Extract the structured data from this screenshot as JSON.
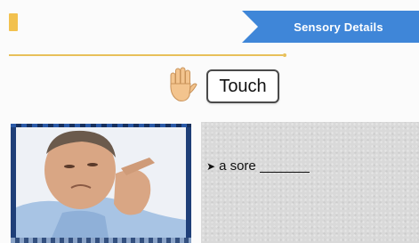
{
  "header": {
    "banner_title": "Sensory Details",
    "banner_color": "#3f86d8",
    "accent_color": "#f2c14e"
  },
  "sense": {
    "label": "Touch",
    "icon": "raised-hand-icon"
  },
  "notes": {
    "bullet_icon": "arrow-bullet-icon",
    "items": [
      {
        "text": "a sore"
      }
    ]
  }
}
